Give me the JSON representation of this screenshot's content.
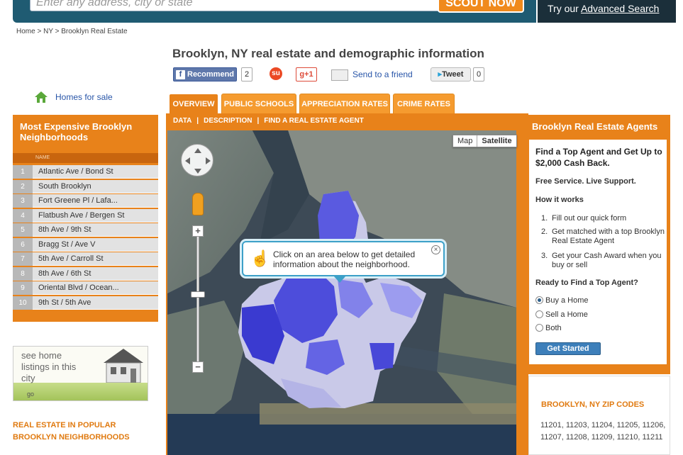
{
  "header": {
    "search_placeholder": "Enter any address, city or state",
    "search_button": "SCOUT NOW",
    "advanced_prefix": "Try our ",
    "advanced_link": "Advanced Search"
  },
  "breadcrumb": {
    "items": [
      "Home",
      "NY",
      "Brooklyn Real Estate"
    ],
    "separator": ">"
  },
  "page": {
    "title": "Brooklyn, NY real estate and demographic information"
  },
  "social": {
    "fb_label": "Recommend",
    "fb_count": "2",
    "gplus_label": "g+1",
    "send_friend": "Send to a friend",
    "tweet_label": "Tweet",
    "tweet_count": "0"
  },
  "homes_for_sale": "Homes for sale",
  "tabs": [
    {
      "label": "OVERVIEW",
      "active": true
    },
    {
      "label": "PUBLIC SCHOOLS",
      "active": false
    },
    {
      "label": "APPRECIATION RATES",
      "active": false
    },
    {
      "label": "CRIME RATES",
      "active": false
    }
  ],
  "subnav": [
    "DATA",
    "DESCRIPTION",
    "FIND A REAL ESTATE AGENT"
  ],
  "map": {
    "type_options": [
      "Map",
      "Satellite"
    ],
    "selected_type": "Satellite",
    "tooltip": "Click on an area below to get detailed information about the neighborhood.",
    "zoom_in": "+",
    "zoom_out": "−",
    "close_symbol": "×"
  },
  "left_panel": {
    "title": "Most Expensive Brooklyn Neighborhoods",
    "column_header": "NAME",
    "neighborhoods": [
      {
        "rank": "1",
        "name": "Atlantic Ave / Bond St"
      },
      {
        "rank": "2",
        "name": "South Brooklyn"
      },
      {
        "rank": "3",
        "name": "Fort Greene Pl / Lafa..."
      },
      {
        "rank": "4",
        "name": "Flatbush Ave / Bergen St"
      },
      {
        "rank": "5",
        "name": "8th Ave / 9th St"
      },
      {
        "rank": "6",
        "name": "Bragg St / Ave V"
      },
      {
        "rank": "7",
        "name": "5th Ave / Carroll St"
      },
      {
        "rank": "8",
        "name": "8th Ave / 6th St"
      },
      {
        "rank": "9",
        "name": "Oriental Blvd / Ocean..."
      },
      {
        "rank": "10",
        "name": "9th St / 5th Ave"
      }
    ],
    "ad_text": "see home listings in this city",
    "ad_go": "go",
    "popular_title": "REAL ESTATE IN POPULAR BROOKLYN NEIGHBORHOODS"
  },
  "right_panel": {
    "title": "Brooklyn Real Estate Agents",
    "find_agent": "Find a Top Agent and Get Up to $2,000 Cash Back.",
    "free_service": "Free Service. Live Support.",
    "how_it_works": "How it works",
    "steps": [
      "Fill out our quick form",
      "Get matched with a top Brooklyn Real Estate Agent",
      "Get your Cash Award when you buy or sell"
    ],
    "ready": "Ready to Find a Top Agent?",
    "options": [
      {
        "label": "Buy a Home",
        "selected": true
      },
      {
        "label": "Sell a Home",
        "selected": false
      },
      {
        "label": "Both",
        "selected": false
      }
    ],
    "button": "Get Started"
  },
  "zip_codes": {
    "title": "BROOKLYN, NY ZIP CODES",
    "list": "11201, 11203, 11204, 11205, 11206, 11207, 11208, 11209, 11210, 11211"
  },
  "colors": {
    "accent_orange": "#e8821a",
    "header_teal": "#1f5b72",
    "link_blue": "#2855a8",
    "map_region_blue": "#4a4ad0"
  }
}
